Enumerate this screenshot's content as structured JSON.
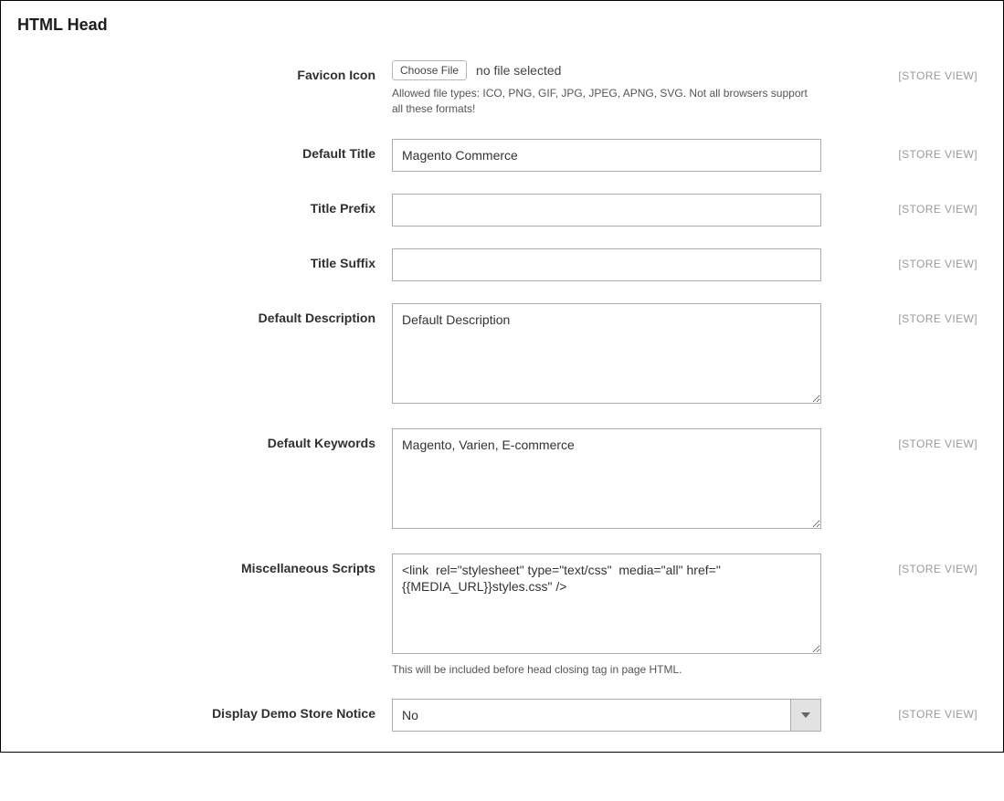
{
  "section": {
    "title": "HTML Head"
  },
  "scope": {
    "label": "[STORE VIEW]"
  },
  "fields": {
    "favicon": {
      "label": "Favicon Icon",
      "button": "Choose File",
      "status": "no file selected",
      "hint": "Allowed file types: ICO, PNG, GIF, JPG, JPEG, APNG, SVG. Not all browsers support all these formats!"
    },
    "default_title": {
      "label": "Default Title",
      "value": "Magento Commerce"
    },
    "title_prefix": {
      "label": "Title Prefix",
      "value": ""
    },
    "title_suffix": {
      "label": "Title Suffix",
      "value": ""
    },
    "default_description": {
      "label": "Default Description",
      "value": "Default Description"
    },
    "default_keywords": {
      "label": "Default Keywords",
      "value": "Magento, Varien, E-commerce"
    },
    "misc_scripts": {
      "label": "Miscellaneous Scripts",
      "value": "<link  rel=\"stylesheet\" type=\"text/css\"  media=\"all\" href=\"{{MEDIA_URL}}styles.css\" />",
      "hint": "This will be included before head closing tag in page HTML."
    },
    "demo_notice": {
      "label": "Display Demo Store Notice",
      "value": "No"
    }
  }
}
